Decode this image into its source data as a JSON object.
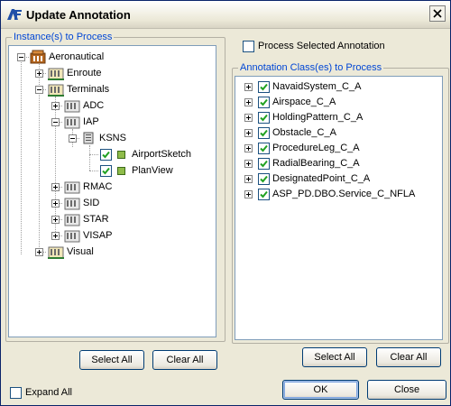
{
  "window": {
    "title": "Update Annotation"
  },
  "instances": {
    "legend": "Instance(s) to Process",
    "root_label": "Aeronautical",
    "enroute": "Enroute",
    "terminals": "Terminals",
    "adc": "ADC",
    "iap": "IAP",
    "ksns": "KSNS",
    "airport_sketch": "AirportSketch",
    "plan_view": "PlanView",
    "rmac": "RMAC",
    "sid": "SID",
    "star": "STAR",
    "visap": "VISAP",
    "visual": "Visual",
    "select_all": "Select All",
    "clear_all": "Clear All"
  },
  "process_selected": {
    "label": "Process Selected Annotation",
    "checked": false
  },
  "classes": {
    "legend": "Annotation Class(es) to Process",
    "items": [
      {
        "label": "NavaidSystem_C_A",
        "checked": true
      },
      {
        "label": "Airspace_C_A",
        "checked": true
      },
      {
        "label": "HoldingPattern_C_A",
        "checked": true
      },
      {
        "label": "Obstacle_C_A",
        "checked": true
      },
      {
        "label": "ProcedureLeg_C_A",
        "checked": true
      },
      {
        "label": "RadialBearing_C_A",
        "checked": true
      },
      {
        "label": "DesignatedPoint_C_A",
        "checked": true
      },
      {
        "label": "ASP_PD.DBO.Service_C_NFLA",
        "checked": true
      }
    ],
    "select_all": "Select All",
    "clear_all": "Clear All"
  },
  "expand_all": {
    "label": "Expand All",
    "checked": false
  },
  "buttons": {
    "ok": "OK",
    "close": "Close"
  }
}
